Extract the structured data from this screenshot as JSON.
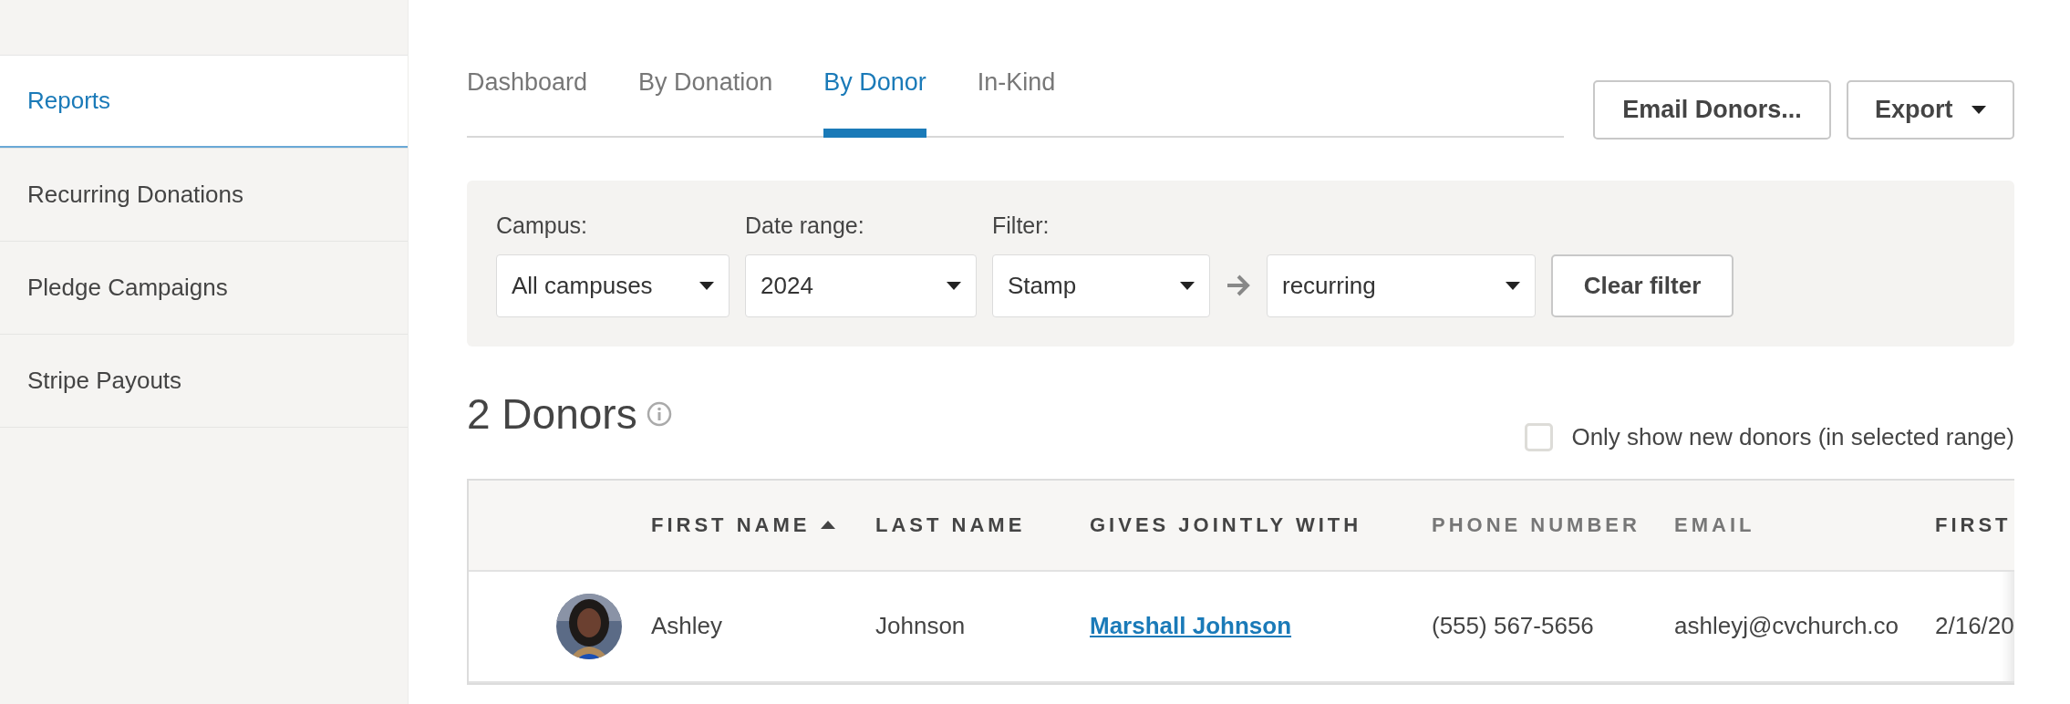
{
  "sidebar": {
    "items": [
      {
        "label": "Reports",
        "selected": true
      },
      {
        "label": "Recurring Donations",
        "selected": false
      },
      {
        "label": "Pledge Campaigns",
        "selected": false
      },
      {
        "label": "Stripe Payouts",
        "selected": false
      }
    ]
  },
  "tabs": [
    {
      "label": "Dashboard",
      "selected": false
    },
    {
      "label": "By Donation",
      "selected": false
    },
    {
      "label": "By Donor",
      "selected": true
    },
    {
      "label": "In-Kind",
      "selected": false
    }
  ],
  "actions": {
    "email": "Email Donors...",
    "export": "Export"
  },
  "filters": {
    "campus": {
      "label": "Campus:",
      "value": "All campuses"
    },
    "date_range": {
      "label": "Date range:",
      "value": "2024"
    },
    "filter": {
      "label": "Filter:",
      "value": "Stamp",
      "sub_value": "recurring"
    },
    "clear": "Clear filter"
  },
  "summary": {
    "title": "2 Donors",
    "new_only": {
      "label": "Only show new donors (in selected range)",
      "checked": false
    }
  },
  "table": {
    "columns": [
      {
        "label": "FIRST NAME",
        "sorted": true
      },
      {
        "label": "LAST NAME",
        "sorted": false
      },
      {
        "label": "GIVES JOINTLY WITH",
        "sorted": false
      },
      {
        "label": "PHONE NUMBER",
        "sorted": false
      },
      {
        "label": "EMAIL",
        "sorted": false
      },
      {
        "label": "FIRST",
        "sorted": false
      }
    ],
    "rows": [
      {
        "first_name": "Ashley",
        "last_name": "Johnson",
        "joint": "Marshall Johnson",
        "phone": "(555) 567-5656",
        "email": "ashleyj@cvchurch.co",
        "first": "2/16/20"
      }
    ]
  }
}
